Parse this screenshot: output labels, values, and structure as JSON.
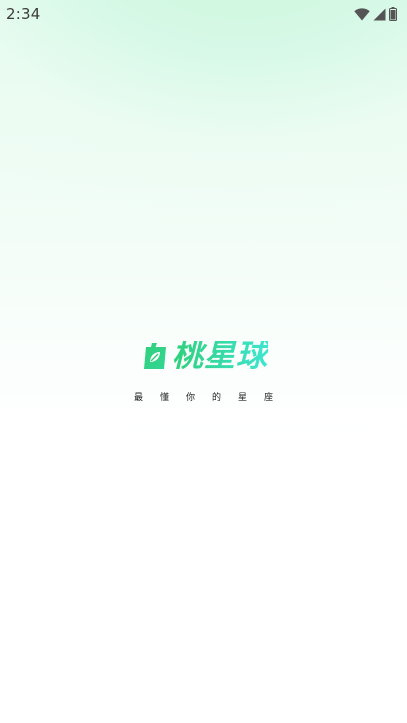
{
  "status_bar": {
    "time": "2:34",
    "icons": [
      "wifi-icon",
      "cellular-signal-icon",
      "battery-icon"
    ]
  },
  "brand": {
    "logo_text": "桃星球",
    "logo_mark": "leaf-square-icon",
    "slogan": "最懂你的星座"
  },
  "colors": {
    "logo_gradient_start": "#2fd07a",
    "logo_gradient_end": "#3ee6cf",
    "background_tint": "#e6fbef"
  }
}
